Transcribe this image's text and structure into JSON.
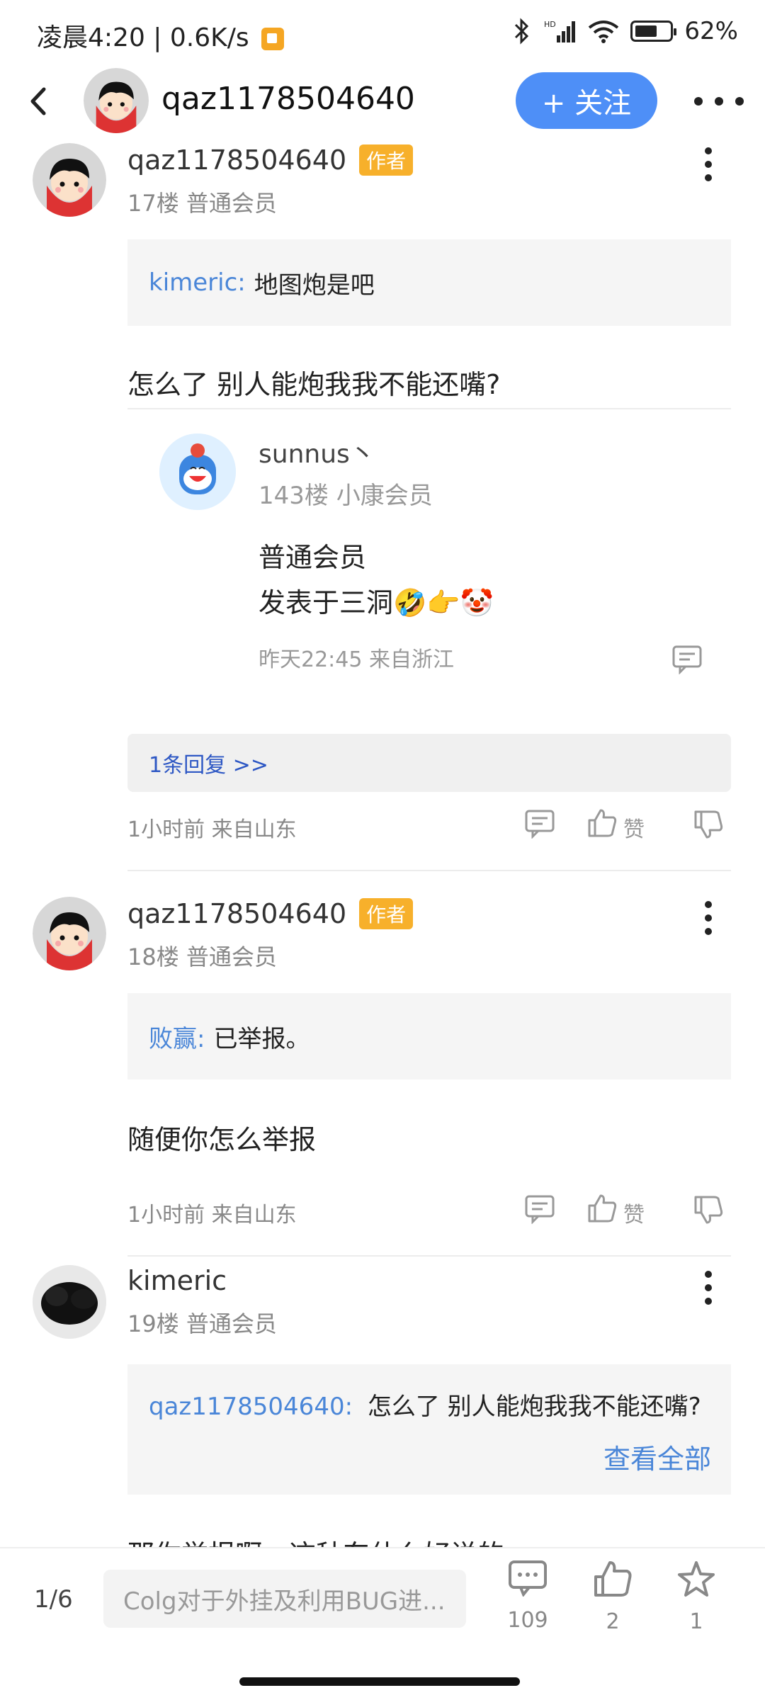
{
  "status": {
    "time_speed": "凌晨4:20 | 0.6K/s",
    "network": "HD",
    "battery": "62%"
  },
  "topbar": {
    "username": "qaz1178504640",
    "follow_label": "+ 关注"
  },
  "posts": [
    {
      "username": "qaz1178504640",
      "author_badge": "作者",
      "floor_info": "17楼 普通会员",
      "quote_name": "kimeric:",
      "quote_text": "地图炮是吧",
      "body": "怎么了 别人能炮我我不能还嘴?",
      "sub_reply": {
        "username": "sunnus丶",
        "floor_info": "143楼 小康会员",
        "line1": "普通会员",
        "line2": "发表于三洞🤣👉🤡",
        "meta": "昨天22:45 来自浙江"
      },
      "replies_label": "1条回复 >>",
      "meta": "1小时前 来自山东",
      "like_label": "赞"
    },
    {
      "username": "qaz1178504640",
      "author_badge": "作者",
      "floor_info": "18楼 普通会员",
      "quote_name": "败赢:",
      "quote_text": "已举报。",
      "body": "随便你怎么举报",
      "meta": "1小时前 来自山东",
      "like_label": "赞"
    },
    {
      "username": "kimeric",
      "floor_info": "19楼 普通会员",
      "quote_name": "qaz1178504640:",
      "quote_text": "怎么了 别人能炮我我不能还嘴?",
      "view_all": "查看全部",
      "body_partial": "那你举报啊，这种东什么好说的"
    }
  ],
  "bottombar": {
    "page_indicator": "1/6",
    "input_placeholder": "Colg对于外挂及利用BUG进...",
    "comments_count": "109",
    "likes_count": "2",
    "favorites_count": "1"
  },
  "colors": {
    "accent": "#4e8ff7",
    "author_badge": "#f7b02b",
    "quote_name": "#4a86d8",
    "replies_link": "#2d57c4"
  }
}
